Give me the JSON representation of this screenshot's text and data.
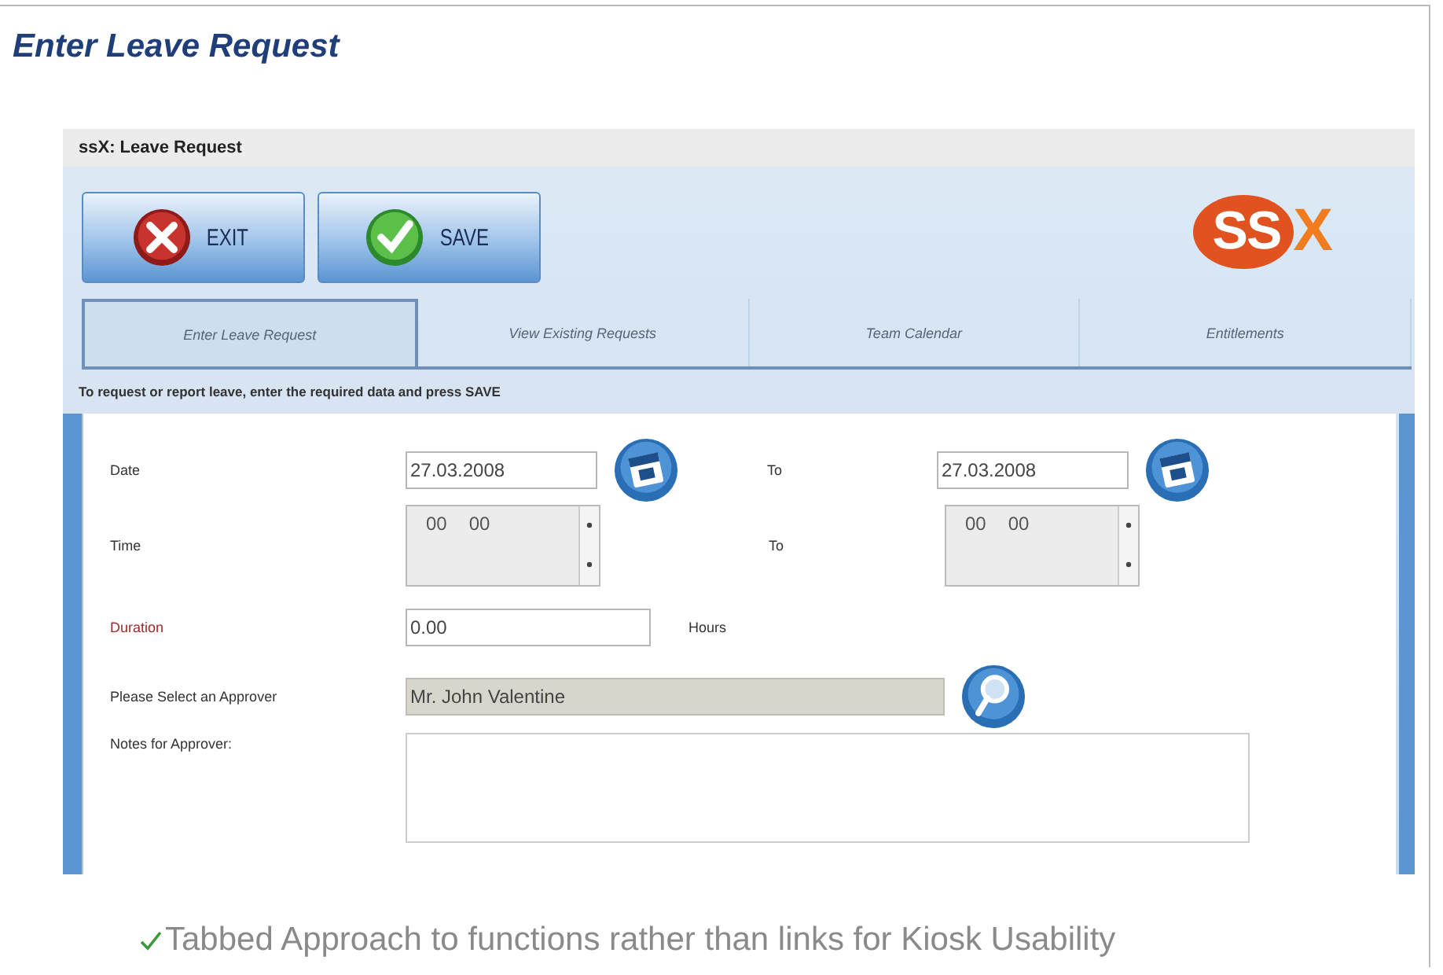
{
  "page_title": "Enter Leave Request",
  "window": {
    "title": "ssX: Leave Request"
  },
  "toolbar": [
    {
      "label": "EXIT",
      "kind": "exit"
    },
    {
      "label": "SAVE",
      "kind": "save"
    }
  ],
  "logo": {
    "main": "SS",
    "accent": "X"
  },
  "tabs": [
    {
      "label": "Enter Leave Request",
      "selected": true
    },
    {
      "label": "View Existing Requests",
      "selected": false
    },
    {
      "label": "Team Calendar",
      "selected": false
    },
    {
      "label": "Entitlements",
      "selected": false
    }
  ],
  "instruction": "To request or report leave, enter the required data and press SAVE",
  "form": {
    "date": {
      "label": "Date",
      "value": "27.03.2008",
      "to_label": "To",
      "to_value": "27.03.2008"
    },
    "time": {
      "label": "Time",
      "hours": "00",
      "minutes": "00",
      "to_label": "To",
      "to_hours": "00",
      "to_minutes": "00"
    },
    "duration": {
      "label": "Duration",
      "value": "0.00",
      "unit": "Hours",
      "required": true
    },
    "approver": {
      "label": "Please Select an Approver",
      "value": "Mr. John Valentine",
      "disabled": true
    },
    "notes": {
      "label": "Notes for Approver:"
    }
  },
  "caption": "Tabbed Approach to functions rather than links for Kiosk Usability"
}
